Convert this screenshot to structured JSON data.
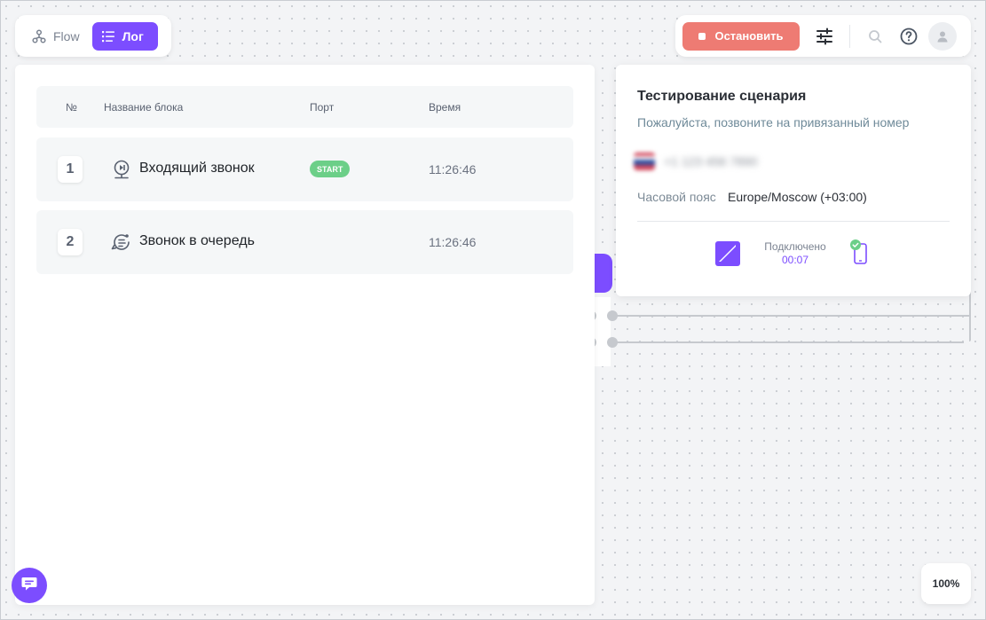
{
  "view_toggle": {
    "flow_label": "Flow",
    "log_label": "Лог"
  },
  "toolbar": {
    "stop_label": "Остановить",
    "icons": [
      "settings-sliders-icon",
      "search-icon",
      "help-icon",
      "user-avatar-icon"
    ]
  },
  "log": {
    "headers": {
      "num": "№",
      "name": "Название блока",
      "port": "Порт",
      "time": "Время"
    },
    "rows": [
      {
        "num": "1",
        "name": "Входящий звонок",
        "port": "START",
        "time": "11:26:46",
        "icon": "incoming-call-icon"
      },
      {
        "num": "2",
        "name": "Звонок в очередь",
        "port": "",
        "time": "11:26:46",
        "icon": "queue-call-icon"
      }
    ]
  },
  "test_panel": {
    "title": "Тестирование сценария",
    "subtitle": "Пожалуйста, позвоните на привязанный номер",
    "phone": "+1 123 456 7890",
    "tz_label": "Часовой пояс",
    "tz_value": "Europe/Moscow (+03:00)",
    "status": "Подключено",
    "timer": "00:07"
  },
  "zoom": "100%",
  "colors": {
    "accent": "#7c4dff",
    "stop": "#ee7b73",
    "start_badge": "#6ccf88"
  }
}
